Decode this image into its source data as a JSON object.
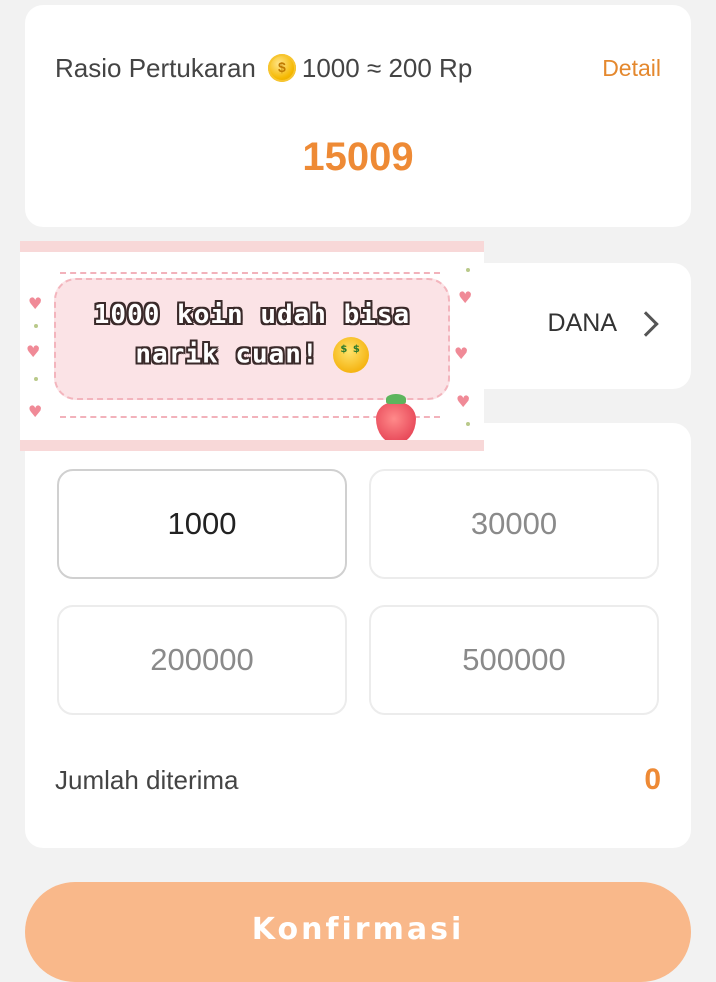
{
  "exchange": {
    "rate_label": "Rasio Pertukaran",
    "coin_icon": "gold-coin-icon",
    "rate_value": "1000 ≈ 200 Rp",
    "detail_label": "Detail",
    "balance": "15009"
  },
  "payment": {
    "method": "DANA"
  },
  "amounts": {
    "options": [
      "1000",
      "30000",
      "200000",
      "500000"
    ],
    "selected": "1000"
  },
  "received": {
    "label": "Jumlah diterima",
    "value": "0"
  },
  "confirm": {
    "label": "Konfirmasi"
  },
  "sticker": {
    "line1": "1000 koin udah bisa",
    "line2": "narik cuan!"
  },
  "colors": {
    "accent": "#ee8a35",
    "button": "#f9b88a",
    "background": "#f2f2f2"
  }
}
